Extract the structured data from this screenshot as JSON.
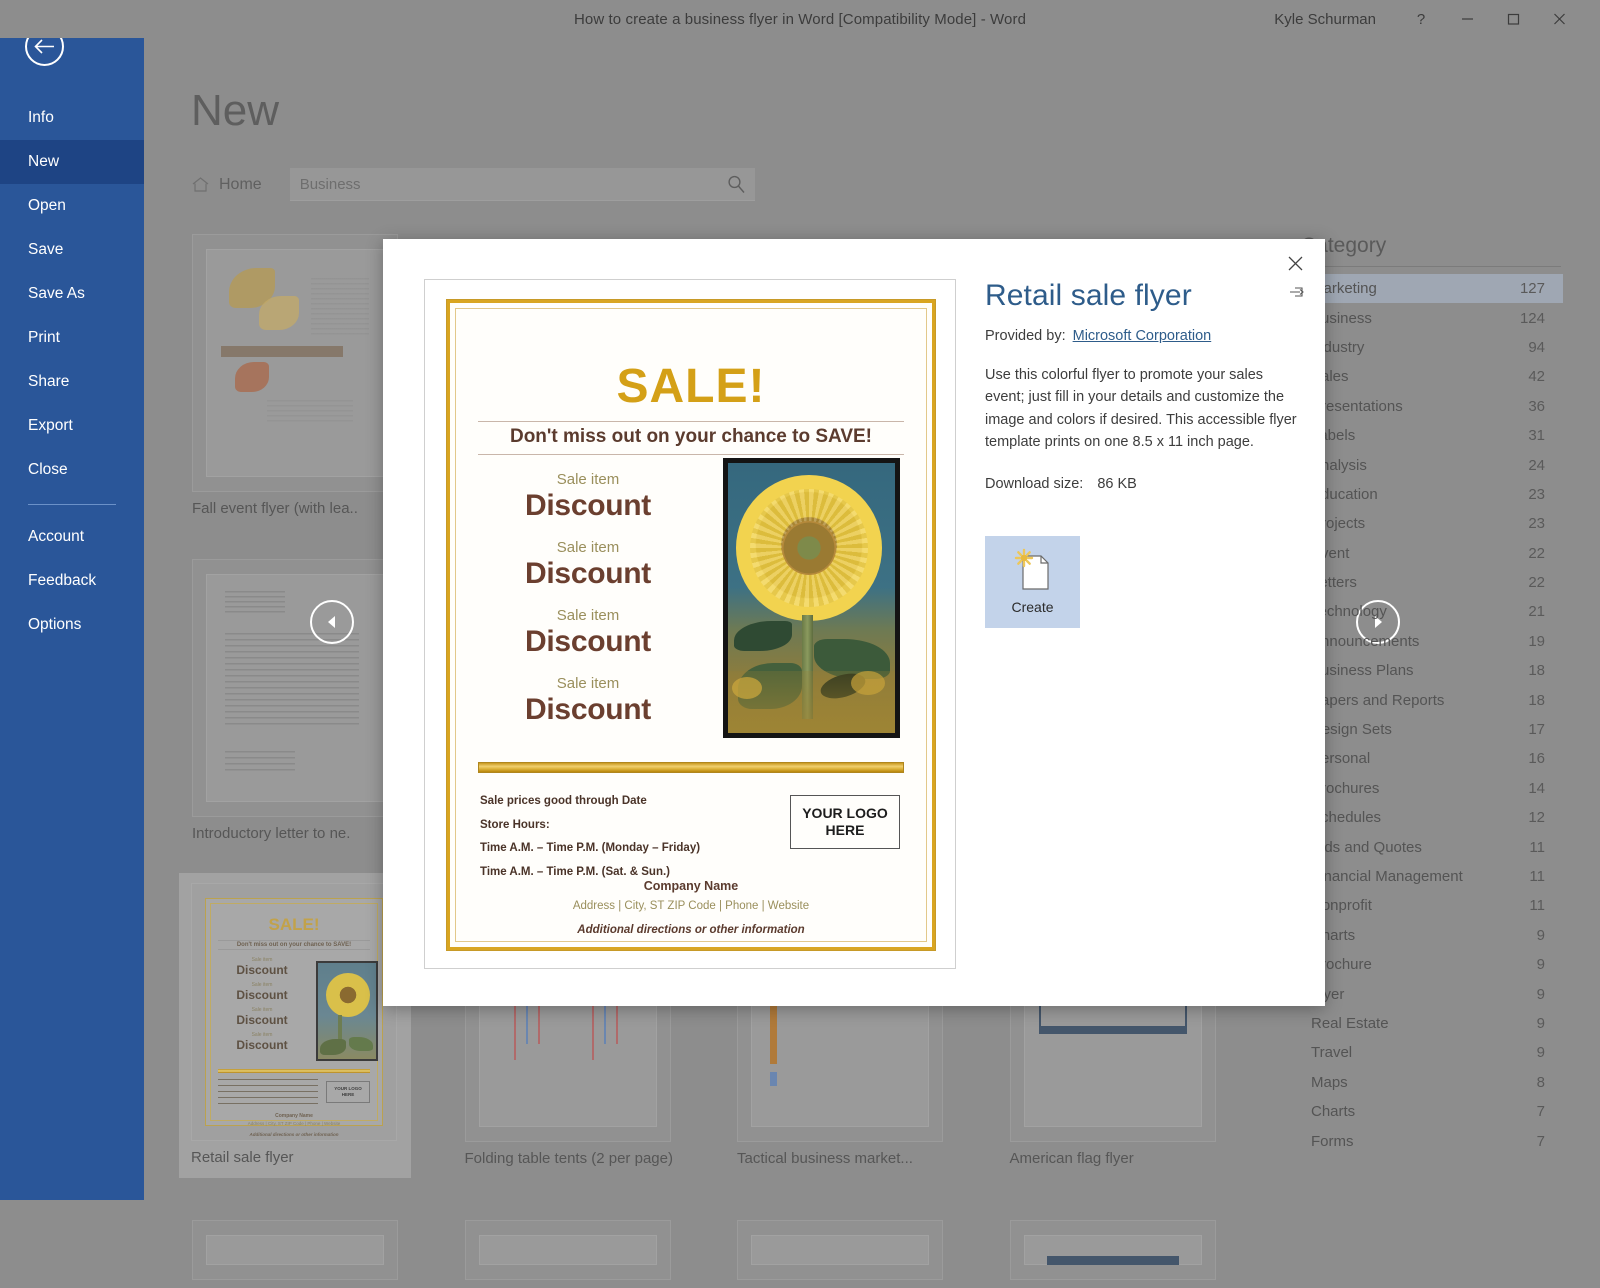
{
  "titlebar": {
    "document_title": "How to create a business flyer in Word [Compatibility Mode]  -  Word",
    "user_name": "Kyle Schurman",
    "help_label": "?",
    "minimize_label": "minimize-icon",
    "restore_label": "restore-icon",
    "close_label": "close-icon"
  },
  "sidebar": {
    "back_label": "back-arrow-icon",
    "items": [
      {
        "label": "Info",
        "active": false
      },
      {
        "label": "New",
        "active": true
      },
      {
        "label": "Open",
        "active": false
      },
      {
        "label": "Save",
        "active": false
      },
      {
        "label": "Save As",
        "active": false
      },
      {
        "label": "Print",
        "active": false
      },
      {
        "label": "Share",
        "active": false
      },
      {
        "label": "Export",
        "active": false
      },
      {
        "label": "Close",
        "active": false
      }
    ],
    "items_bottom": [
      {
        "label": "Account"
      },
      {
        "label": "Feedback"
      },
      {
        "label": "Options"
      }
    ]
  },
  "backstage": {
    "page_title": "New",
    "home_label": "Home",
    "search_value": "Business",
    "thumbnails": [
      {
        "label": "Fall event flyer (with lea..",
        "selected": false
      },
      {
        "label": "Introductory letter to ne.",
        "selected": false
      },
      {
        "label": "Retail sale flyer",
        "selected": true
      },
      {
        "label": "Folding table tents (2 per page)",
        "selected": false
      },
      {
        "label": "Tactical business market...",
        "selected": false
      },
      {
        "label": "American flag flyer",
        "selected": false
      }
    ],
    "prev_label": "previous-page-arrow",
    "next_label": "next-page-arrow"
  },
  "category_panel": {
    "header": "Category",
    "rows": [
      {
        "name": "Marketing",
        "count": "127",
        "highlighted": true
      },
      {
        "name": "Business",
        "count": "124",
        "highlighted": false
      },
      {
        "name": "Industry",
        "count": "94",
        "highlighted": false
      },
      {
        "name": "Sales",
        "count": "42",
        "highlighted": false
      },
      {
        "name": "Presentations",
        "count": "36",
        "highlighted": false
      },
      {
        "name": "Labels",
        "count": "31",
        "highlighted": false
      },
      {
        "name": "Analysis",
        "count": "24",
        "highlighted": false
      },
      {
        "name": "Education",
        "count": "23",
        "highlighted": false
      },
      {
        "name": "Projects",
        "count": "23",
        "highlighted": false
      },
      {
        "name": "Event",
        "count": "22",
        "highlighted": false
      },
      {
        "name": "Letters",
        "count": "22",
        "highlighted": false
      },
      {
        "name": "Technology",
        "count": "21",
        "highlighted": false
      },
      {
        "name": "Announcements",
        "count": "19",
        "highlighted": false
      },
      {
        "name": "Business Plans",
        "count": "18",
        "highlighted": false
      },
      {
        "name": "Papers and Reports",
        "count": "18",
        "highlighted": false
      },
      {
        "name": "Design Sets",
        "count": "17",
        "highlighted": false
      },
      {
        "name": "Personal",
        "count": "16",
        "highlighted": false
      },
      {
        "name": "Brochures",
        "count": "14",
        "highlighted": false
      },
      {
        "name": "Schedules",
        "count": "12",
        "highlighted": false
      },
      {
        "name": "Bids and Quotes",
        "count": "11",
        "highlighted": false
      },
      {
        "name": "Financial Management",
        "count": "11",
        "highlighted": false
      },
      {
        "name": "Nonprofit",
        "count": "11",
        "highlighted": false
      },
      {
        "name": "Charts",
        "count": "9",
        "highlighted": false
      },
      {
        "name": "Brochure",
        "count": "9",
        "highlighted": false
      },
      {
        "name": "Flyer",
        "count": "9",
        "highlighted": false
      },
      {
        "name": "Real Estate",
        "count": "9",
        "highlighted": false
      },
      {
        "name": "Travel",
        "count": "9",
        "highlighted": false
      },
      {
        "name": "Maps",
        "count": "8",
        "highlighted": false
      },
      {
        "name": "Charts",
        "count": "7",
        "highlighted": false
      },
      {
        "name": "Forms",
        "count": "7",
        "highlighted": false
      }
    ]
  },
  "dialog": {
    "close_label": "close-icon",
    "pin_label": "pin-icon",
    "title": "Retail sale flyer",
    "provided_by_label": "Provided by:",
    "provider_link": "Microsoft Corporation",
    "description": "Use this colorful flyer to promote your sales event; just fill in your details and customize the image and colors if desired. This accessible flyer template prints on one 8.5 x 11 inch page.",
    "download_size_label": "Download size:",
    "download_size_value": "86 KB",
    "create_label": "Create",
    "flyer": {
      "headline": "SALE!",
      "tagline": "Don't miss out on your chance to SAVE!",
      "items": [
        {
          "small": "Sale item",
          "big": "Discount"
        },
        {
          "small": "Sale item",
          "big": "Discount"
        },
        {
          "small": "Sale item",
          "big": "Discount"
        },
        {
          "small": "Sale item",
          "big": "Discount"
        }
      ],
      "photo_alt": "sunflower-photo",
      "hours_lines": [
        "Sale prices good through Date",
        "Store Hours:",
        "Time A.M. – Time P.M. (Monday – Friday)",
        "Time A.M. – Time P.M. (Sat. & Sun.)"
      ],
      "logo_line1": "YOUR LOGO",
      "logo_line2": "HERE",
      "company_name": "Company Name",
      "address_line": "Address  |  City, ST ZIP Code  |  Phone  |  Website",
      "additional_line": "Additional directions or other information"
    }
  },
  "colors": {
    "office_blue": "#2a5699",
    "office_blue_active": "#1e4484",
    "dim_gray": "#8d8d8d",
    "gold": "#d4a017",
    "brown": "#6b3f2f",
    "link_blue": "#2e5c8a"
  }
}
